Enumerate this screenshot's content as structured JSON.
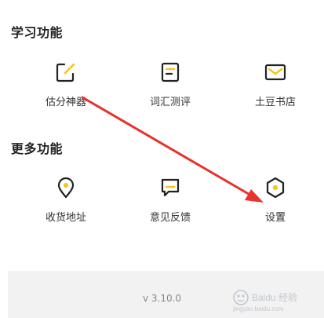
{
  "colors": {
    "accent": "#f5c518",
    "icon_stroke": "#222222",
    "arrow": "#e8322c",
    "footer_bg": "#f2f2f2"
  },
  "study_section": {
    "title": "学习功能",
    "items": [
      {
        "label": "估分神器",
        "icon": "edit-icon"
      },
      {
        "label": "词汇测评",
        "icon": "document-icon"
      },
      {
        "label": "土豆书店",
        "icon": "mail-icon"
      }
    ]
  },
  "more_section": {
    "title": "更多功能",
    "items": [
      {
        "label": "收货地址",
        "icon": "location-pin-icon"
      },
      {
        "label": "意见反馈",
        "icon": "chat-icon"
      },
      {
        "label": "设置",
        "icon": "settings-hexagon-icon"
      }
    ]
  },
  "footer": {
    "version": "v 3.10.0"
  },
  "watermark": {
    "brand": "Baidu 经验",
    "url": "jingyan.baidu.com"
  }
}
